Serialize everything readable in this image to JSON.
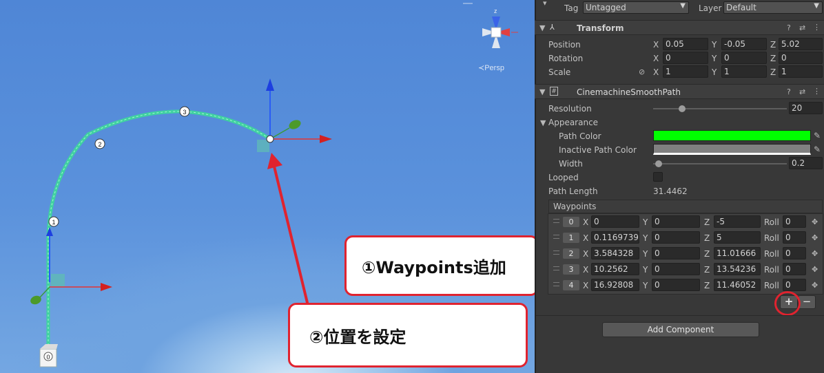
{
  "scene": {
    "persp_label": "≺Persp",
    "gizmo_axis_label": "z",
    "waypoint_labels": [
      "0",
      "1",
      "2",
      "3"
    ]
  },
  "callouts": {
    "add_waypoints": "①Waypoints追加",
    "set_position": "②位置を設定"
  },
  "inspector": {
    "tag_label": "Tag",
    "tag_value": "Untagged",
    "layer_label": "Layer",
    "layer_value": "Default",
    "transform": {
      "title": "Transform",
      "position": {
        "label": "Position",
        "x": "0.05",
        "y": "-0.05",
        "z": "5.02"
      },
      "rotation": {
        "label": "Rotation",
        "x": "0",
        "y": "0",
        "z": "0"
      },
      "scale": {
        "label": "Scale",
        "x": "1",
        "y": "1",
        "z": "1"
      }
    },
    "smooth_path": {
      "title": "CinemachineSmoothPath",
      "resolution_label": "Resolution",
      "resolution_value": "20",
      "resolution_level": 0.2,
      "appearance_label": "Appearance",
      "path_color_label": "Path Color",
      "path_color": "#00ff00",
      "inactive_path_color_label": "Inactive Path Color",
      "inactive_path_color": "#808080",
      "width_label": "Width",
      "width_value": "0.2",
      "looped_label": "Looped",
      "looped": false,
      "path_length_label": "Path Length",
      "path_length_value": "31.4462",
      "waypoints_label": "Waypoints",
      "axis_x": "X",
      "axis_y": "Y",
      "axis_z": "Z",
      "roll_label": "Roll",
      "waypoints": [
        {
          "index": "0",
          "x": "0",
          "y": "0",
          "z": "-5",
          "roll": "0"
        },
        {
          "index": "1",
          "x": "0.1169739",
          "y": "0",
          "z": "5",
          "roll": "0"
        },
        {
          "index": "2",
          "x": "3.584328",
          "y": "0",
          "z": "11.01666",
          "roll": "0"
        },
        {
          "index": "3",
          "x": "10.2562",
          "y": "0",
          "z": "13.54236",
          "roll": "0"
        },
        {
          "index": "4",
          "x": "16.92808",
          "y": "0",
          "z": "11.46052",
          "roll": "0"
        }
      ],
      "add_symbol": "+",
      "remove_symbol": "−"
    },
    "add_component_label": "Add Component"
  },
  "colors": {
    "accent_red": "#e0232f",
    "path_green": "#3fd2a0"
  }
}
